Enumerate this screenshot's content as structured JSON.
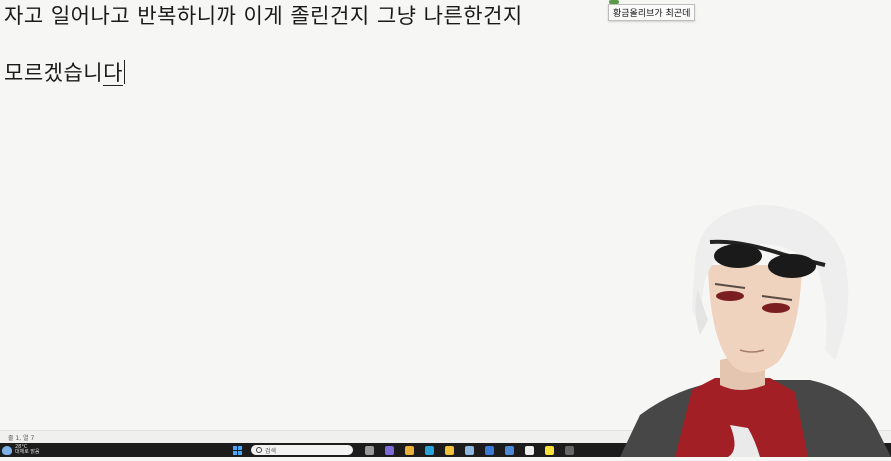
{
  "document": {
    "line1": "자고 일어나고 반복하니까 이게 졸린건지 그냥 나른한건지",
    "line2_main": "모르겠습니",
    "line2_tail": "다"
  },
  "tooltip": {
    "text": "황금올리브가 최곤데"
  },
  "statusbar": {
    "text": "줄 1, 열 7"
  },
  "taskbar": {
    "weather_temp": "28°C",
    "weather_desc": "대체로 맑음",
    "search_placeholder": "검색",
    "apps": [
      {
        "name": "task-view-icon",
        "color": "#9a9a9a"
      },
      {
        "name": "copilot-icon",
        "color": "#7d6bd9"
      },
      {
        "name": "chrome-icon",
        "color": "#e9b33b"
      },
      {
        "name": "edge-icon",
        "color": "#2aa4d8"
      },
      {
        "name": "file-explorer-icon",
        "color": "#f2c23a"
      },
      {
        "name": "notepad-icon",
        "color": "#8fb8e0"
      },
      {
        "name": "mail-icon",
        "color": "#3a7ad4"
      },
      {
        "name": "store-icon",
        "color": "#4c8ad6"
      },
      {
        "name": "capcut-icon",
        "color": "#eeeeee"
      },
      {
        "name": "kakaotalk-icon",
        "color": "#f7e13a"
      },
      {
        "name": "obs-icon",
        "color": "#666666"
      }
    ]
  },
  "colors": {
    "background": "#f6f6f4",
    "taskbar": "#1c1c1c",
    "shirt": "#a31f26",
    "jacket": "#4a4a4a",
    "hair": "#eeeeee"
  }
}
